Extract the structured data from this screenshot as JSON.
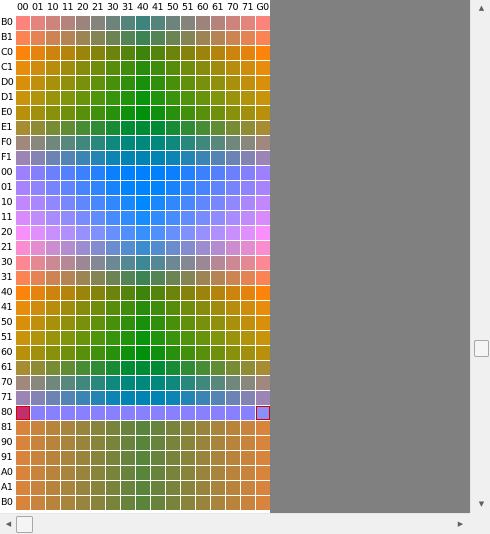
{
  "grid": {
    "column_headers": [
      "00",
      "01",
      "10",
      "11",
      "20",
      "21",
      "30",
      "31",
      "40",
      "41",
      "50",
      "51",
      "60",
      "61",
      "70",
      "71",
      "G0"
    ],
    "row_headers": [
      "B0",
      "B1",
      "C0",
      "C1",
      "D0",
      "D1",
      "E0",
      "E1",
      "F0",
      "F1",
      "00",
      "01",
      "10",
      "11",
      "20",
      "21",
      "30",
      "31",
      "40",
      "41",
      "50",
      "51",
      "60",
      "61",
      "70",
      "71",
      "80",
      "81",
      "90",
      "91",
      "A0",
      "A1",
      "B0"
    ],
    "selected_row": "80",
    "cell_colors": [
      [
        "#fc847c",
        "#e4847c",
        "#cc847c",
        "#b4847c",
        "#9c847c",
        "#84847c",
        "#6c847c",
        "#54847c",
        "#3c847c",
        "#54847c",
        "#6c847c",
        "#84847c",
        "#9c847c",
        "#b4847c",
        "#cc847c",
        "#e4847c",
        "#fc847c"
      ],
      [
        "#fc8454",
        "#e48454",
        "#cc8454",
        "#b48454",
        "#9c8454",
        "#848454",
        "#6c8454",
        "#548454",
        "#3c8454",
        "#548454",
        "#6c8454",
        "#848454",
        "#9c8454",
        "#b48454",
        "#cc8454",
        "#e48454",
        "#fc8454"
      ],
      [
        "#fc840c",
        "#e4840c",
        "#cc840c",
        "#b4840c",
        "#9c840c",
        "#84840c",
        "#6c840c",
        "#54840c",
        "#3c840c",
        "#54840c",
        "#6c840c",
        "#84840c",
        "#9c840c",
        "#b4840c",
        "#cc840c",
        "#e4840c",
        "#fc840c"
      ],
      [
        "#e88c0c",
        "#d08c0c",
        "#b88c0c",
        "#a08c0c",
        "#888c0c",
        "#708c0c",
        "#588c0c",
        "#408c0c",
        "#288c0c",
        "#408c0c",
        "#588c0c",
        "#708c0c",
        "#888c0c",
        "#a08c0c",
        "#b88c0c",
        "#d08c0c",
        "#e88c0c"
      ],
      [
        "#d8900c",
        "#c0900c",
        "#a8900c",
        "#90900c",
        "#78900c",
        "#60900c",
        "#48900c",
        "#30900c",
        "#18900c",
        "#30900c",
        "#48900c",
        "#60900c",
        "#78900c",
        "#90900c",
        "#a8900c",
        "#c0900c",
        "#d8900c"
      ],
      [
        "#c8940c",
        "#b0940c",
        "#98940c",
        "#80940c",
        "#68940c",
        "#50940c",
        "#38940c",
        "#20940c",
        "#08940c",
        "#20940c",
        "#38940c",
        "#50940c",
        "#68940c",
        "#80940c",
        "#98940c",
        "#b0940c",
        "#c8940c"
      ],
      [
        "#b8900c",
        "#a0900c",
        "#88900c",
        "#70900c",
        "#58900c",
        "#40900c",
        "#28900c",
        "#10900c",
        "#00900c",
        "#10900c",
        "#28900c",
        "#40900c",
        "#58900c",
        "#70900c",
        "#88900c",
        "#a0900c",
        "#b8900c"
      ],
      [
        "#a88c34",
        "#908c34",
        "#788c34",
        "#608c34",
        "#488c34",
        "#308c34",
        "#188c34",
        "#008c34",
        "#008c34",
        "#008c34",
        "#188c34",
        "#308c34",
        "#488c34",
        "#608c34",
        "#788c34",
        "#908c34",
        "#a88c34"
      ],
      [
        "#a0887c",
        "#88887c",
        "#70887c",
        "#58887c",
        "#40887c",
        "#28887c",
        "#10887c",
        "#00887c",
        "#00887c",
        "#00887c",
        "#10887c",
        "#28887c",
        "#40887c",
        "#58887c",
        "#70887c",
        "#88887c",
        "#a0887c"
      ],
      [
        "#9c84b4",
        "#8484b4",
        "#6c84b4",
        "#5484b4",
        "#3c84b4",
        "#2484b4",
        "#0c84b4",
        "#0084b4",
        "#0084b4",
        "#0084b4",
        "#0c84b4",
        "#2484b4",
        "#3c84b4",
        "#5484b4",
        "#6c84b4",
        "#8484b4",
        "#9c84b4"
      ],
      [
        "#9c80fc",
        "#8480fc",
        "#6c80fc",
        "#5480fc",
        "#3c80fc",
        "#2480fc",
        "#0c80fc",
        "#0080fc",
        "#0080fc",
        "#0080fc",
        "#0c80fc",
        "#2480fc",
        "#3c80fc",
        "#5480fc",
        "#6c80fc",
        "#8480fc",
        "#9c80fc"
      ],
      [
        "#a884fc",
        "#9084fc",
        "#7884fc",
        "#6084fc",
        "#4884fc",
        "#3084fc",
        "#1884fc",
        "#0084fc",
        "#0084fc",
        "#0084fc",
        "#1884fc",
        "#3084fc",
        "#4884fc",
        "#6084fc",
        "#7884fc",
        "#9084fc",
        "#a884fc"
      ],
      [
        "#c088fc",
        "#a888fc",
        "#9088fc",
        "#7888fc",
        "#6088fc",
        "#4888fc",
        "#3088fc",
        "#1888fc",
        "#0088fc",
        "#1888fc",
        "#3088fc",
        "#4888fc",
        "#6088fc",
        "#7888fc",
        "#9088fc",
        "#a888fc",
        "#c088fc"
      ],
      [
        "#d88cfc",
        "#c08cfc",
        "#a88cfc",
        "#908cfc",
        "#788cfc",
        "#608cfc",
        "#488cfc",
        "#308cfc",
        "#188cfc",
        "#308cfc",
        "#488cfc",
        "#608cfc",
        "#788cfc",
        "#908cfc",
        "#a88cfc",
        "#c08cfc",
        "#d88cfc"
      ],
      [
        "#f890fc",
        "#e090fc",
        "#c890fc",
        "#b090fc",
        "#9890fc",
        "#8090fc",
        "#6890fc",
        "#5090fc",
        "#3890fc",
        "#5090fc",
        "#6890fc",
        "#8090fc",
        "#9890fc",
        "#b090fc",
        "#c890fc",
        "#e090fc",
        "#f890fc"
      ],
      [
        "#fc8cd0",
        "#e48cd0",
        "#cc8cd0",
        "#b48cd0",
        "#9c8cd0",
        "#848cd0",
        "#6c8cd0",
        "#548cd0",
        "#3c8cd0",
        "#548cd0",
        "#6c8cd0",
        "#848cd0",
        "#9c8cd0",
        "#b48cd0",
        "#cc8cd0",
        "#e48cd0",
        "#fc8cd0"
      ],
      [
        "#fc8894",
        "#e48894",
        "#cc8894",
        "#b48894",
        "#9c8894",
        "#848894",
        "#6c8894",
        "#548894",
        "#3c8894",
        "#548894",
        "#6c8894",
        "#848894",
        "#9c8894",
        "#b48894",
        "#cc8894",
        "#e48894",
        "#fc8894"
      ],
      [
        "#fc8454",
        "#e48454",
        "#cc8454",
        "#b48454",
        "#9c8454",
        "#848454",
        "#6c8454",
        "#548454",
        "#3c8454",
        "#548454",
        "#6c8454",
        "#848454",
        "#9c8454",
        "#b48454",
        "#cc8454",
        "#e48454",
        "#fc8454"
      ],
      [
        "#fc840c",
        "#e4840c",
        "#cc840c",
        "#b4840c",
        "#9c840c",
        "#84840c",
        "#6c840c",
        "#54840c",
        "#3c840c",
        "#54840c",
        "#6c840c",
        "#84840c",
        "#9c840c",
        "#b4840c",
        "#cc840c",
        "#e4840c",
        "#fc840c"
      ],
      [
        "#e88c0c",
        "#d08c0c",
        "#b88c0c",
        "#a08c0c",
        "#888c0c",
        "#708c0c",
        "#588c0c",
        "#408c0c",
        "#288c0c",
        "#408c0c",
        "#588c0c",
        "#708c0c",
        "#888c0c",
        "#a08c0c",
        "#b88c0c",
        "#d08c0c",
        "#e88c0c"
      ],
      [
        "#d8900c",
        "#c0900c",
        "#a8900c",
        "#90900c",
        "#78900c",
        "#60900c",
        "#48900c",
        "#30900c",
        "#18900c",
        "#30900c",
        "#48900c",
        "#60900c",
        "#78900c",
        "#90900c",
        "#a8900c",
        "#c0900c",
        "#d8900c"
      ],
      [
        "#c8940c",
        "#b0940c",
        "#98940c",
        "#80940c",
        "#68940c",
        "#50940c",
        "#38940c",
        "#20940c",
        "#08940c",
        "#20940c",
        "#38940c",
        "#50940c",
        "#68940c",
        "#80940c",
        "#98940c",
        "#b0940c",
        "#c8940c"
      ],
      [
        "#b8900c",
        "#a0900c",
        "#88900c",
        "#70900c",
        "#58900c",
        "#40900c",
        "#28900c",
        "#10900c",
        "#00900c",
        "#10900c",
        "#28900c",
        "#40900c",
        "#58900c",
        "#70900c",
        "#88900c",
        "#a0900c",
        "#b8900c"
      ],
      [
        "#a88c34",
        "#908c34",
        "#788c34",
        "#608c34",
        "#488c34",
        "#308c34",
        "#188c34",
        "#008c34",
        "#008c34",
        "#008c34",
        "#188c34",
        "#308c34",
        "#488c34",
        "#608c34",
        "#788c34",
        "#908c34",
        "#a88c34"
      ],
      [
        "#a0887c",
        "#88887c",
        "#70887c",
        "#58887c",
        "#40887c",
        "#28887c",
        "#10887c",
        "#00887c",
        "#00887c",
        "#00887c",
        "#10887c",
        "#28887c",
        "#40887c",
        "#58887c",
        "#70887c",
        "#88887c",
        "#a0887c"
      ],
      [
        "#9c84b4",
        "#8484b4",
        "#6c84b4",
        "#5484b4",
        "#3c84b4",
        "#2484b4",
        "#0c84b4",
        "#0084b4",
        "#0084b4",
        "#0084b4",
        "#0c84b4",
        "#2484b4",
        "#3c84b4",
        "#5484b4",
        "#6c84b4",
        "#8484b4",
        "#9c84b4"
      ],
      [
        "#9c80fc",
        "#8880fc",
        "#8880fc",
        "#8880fc",
        "#8880fc",
        "#8880fc",
        "#8880fc",
        "#8880fc",
        "#8880fc",
        "#8880fc",
        "#8880fc",
        "#8880fc",
        "#8880fc",
        "#8880fc",
        "#8880fc",
        "#8880fc",
        "#9c80fc"
      ],
      [
        "#d8843c",
        "#c8843c",
        "#b8843c",
        "#a8843c",
        "#98843c",
        "#88843c",
        "#78843c",
        "#68843c",
        "#58843c",
        "#68843c",
        "#78843c",
        "#88843c",
        "#98843c",
        "#a8843c",
        "#b8843c",
        "#c8843c",
        "#d8843c"
      ],
      [
        "#d8843c",
        "#c8843c",
        "#b8843c",
        "#a8843c",
        "#98843c",
        "#88843c",
        "#78843c",
        "#68843c",
        "#58843c",
        "#68843c",
        "#78843c",
        "#88843c",
        "#98843c",
        "#a8843c",
        "#b8843c",
        "#c8843c",
        "#d8843c"
      ],
      [
        "#d8843c",
        "#c8843c",
        "#b8843c",
        "#a8843c",
        "#98843c",
        "#88843c",
        "#78843c",
        "#68843c",
        "#58843c",
        "#68843c",
        "#78843c",
        "#88843c",
        "#98843c",
        "#a8843c",
        "#b8843c",
        "#c8843c",
        "#d8843c"
      ],
      [
        "#d8843c",
        "#c8843c",
        "#b8843c",
        "#a8843c",
        "#98843c",
        "#88843c",
        "#78843c",
        "#68843c",
        "#58843c",
        "#68843c",
        "#78843c",
        "#88843c",
        "#98843c",
        "#a8843c",
        "#b8843c",
        "#c8843c",
        "#d8843c"
      ],
      [
        "#d8843c",
        "#c8843c",
        "#b8843c",
        "#a8843c",
        "#98843c",
        "#88843c",
        "#78843c",
        "#68843c",
        "#58843c",
        "#68843c",
        "#78843c",
        "#88843c",
        "#98843c",
        "#a8843c",
        "#b8843c",
        "#c8843c",
        "#d8843c"
      ],
      [
        "#d8843c",
        "#c8843c",
        "#b8843c",
        "#a8843c",
        "#98843c",
        "#88843c",
        "#78843c",
        "#68843c",
        "#58843c",
        "#68843c",
        "#78843c",
        "#88843c",
        "#98843c",
        "#a8843c",
        "#b8843c",
        "#c8843c",
        "#d8843c"
      ]
    ],
    "marker_colors": {
      "left_fill": "#c03070",
      "left_border": "#e00000",
      "right_fill": "#8890fc",
      "right_border": "#d00000"
    }
  },
  "scrollbars": {
    "up_arrow": "▲",
    "down_arrow": "▼",
    "left_arrow": "◀",
    "right_arrow": "▶"
  },
  "colors": {
    "background_panel": "#808080",
    "scrollbar_track": "#f0f0f0"
  }
}
